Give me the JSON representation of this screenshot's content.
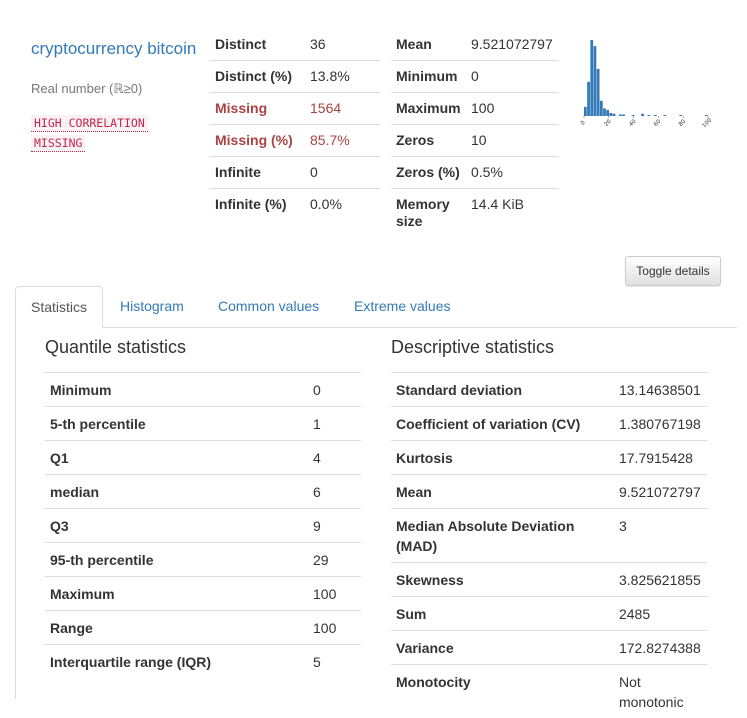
{
  "variable": {
    "name": "cryptocurrency bitcoin",
    "type": "Real number (ℝ≥0)",
    "alerts": [
      "HIGH CORRELATION",
      "MISSING"
    ]
  },
  "overview_left": [
    {
      "label": "Distinct",
      "value": "36",
      "alert": false
    },
    {
      "label": "Distinct (%)",
      "value": "13.8%",
      "alert": false
    },
    {
      "label": "Missing",
      "value": "1564",
      "alert": true
    },
    {
      "label": "Missing (%)",
      "value": "85.7%",
      "alert": true
    },
    {
      "label": "Infinite",
      "value": "0",
      "alert": false
    },
    {
      "label": "Infinite (%)",
      "value": "0.0%",
      "alert": false
    }
  ],
  "overview_right": [
    {
      "label": "Mean",
      "value": "9.521072797"
    },
    {
      "label": "Minimum",
      "value": "0"
    },
    {
      "label": "Maximum",
      "value": "100"
    },
    {
      "label": "Zeros",
      "value": "10"
    },
    {
      "label": "Zeros (%)",
      "value": "0.5%"
    },
    {
      "label": "Memory size",
      "value": "14.4 KiB"
    }
  ],
  "mini_histogram": {
    "color": "#337ab7",
    "x_ticks": [
      "0",
      "20",
      "40",
      "60",
      "80",
      "100"
    ],
    "xlim": [
      0,
      100
    ],
    "bins": [
      0.12,
      0.45,
      1.0,
      0.92,
      0.62,
      0.2,
      0.1,
      0.08,
      0.04,
      0.03,
      0.0,
      0.02,
      0.02,
      0.0,
      0.0,
      0.01,
      0.0,
      0.0,
      0.03,
      0.0,
      0.01,
      0.0,
      0.01,
      0.0,
      0.0,
      0.01,
      0.0,
      0.0,
      0.0,
      0.0,
      0.01,
      0.0,
      0.0,
      0.0,
      0.0,
      0.0,
      0.0,
      0.0,
      0.01
    ]
  },
  "toggle_label": "Toggle details",
  "tabs": [
    "Statistics",
    "Histogram",
    "Common values",
    "Extreme values"
  ],
  "quantile": {
    "title": "Quantile statistics",
    "rows": [
      {
        "label": "Minimum",
        "value": "0"
      },
      {
        "label": "5-th percentile",
        "value": "1"
      },
      {
        "label": "Q1",
        "value": "4"
      },
      {
        "label": "median",
        "value": "6"
      },
      {
        "label": "Q3",
        "value": "9"
      },
      {
        "label": "95-th percentile",
        "value": "29"
      },
      {
        "label": "Maximum",
        "value": "100"
      },
      {
        "label": "Range",
        "value": "100"
      },
      {
        "label": "Interquartile range (IQR)",
        "value": "5"
      }
    ]
  },
  "descriptive": {
    "title": "Descriptive statistics",
    "rows": [
      {
        "label": "Standard deviation",
        "value": "13.14638501"
      },
      {
        "label": "Coefficient of variation (CV)",
        "value": "1.380767198"
      },
      {
        "label": "Kurtosis",
        "value": "17.7915428"
      },
      {
        "label": "Mean",
        "value": "9.521072797"
      },
      {
        "label": "Median Absolute Deviation (MAD)",
        "value": "3"
      },
      {
        "label": "Skewness",
        "value": "3.825621855"
      },
      {
        "label": "Sum",
        "value": "2485"
      },
      {
        "label": "Variance",
        "value": "172.8274388"
      },
      {
        "label": "Monotocity",
        "value": "Not monotonic"
      }
    ]
  }
}
